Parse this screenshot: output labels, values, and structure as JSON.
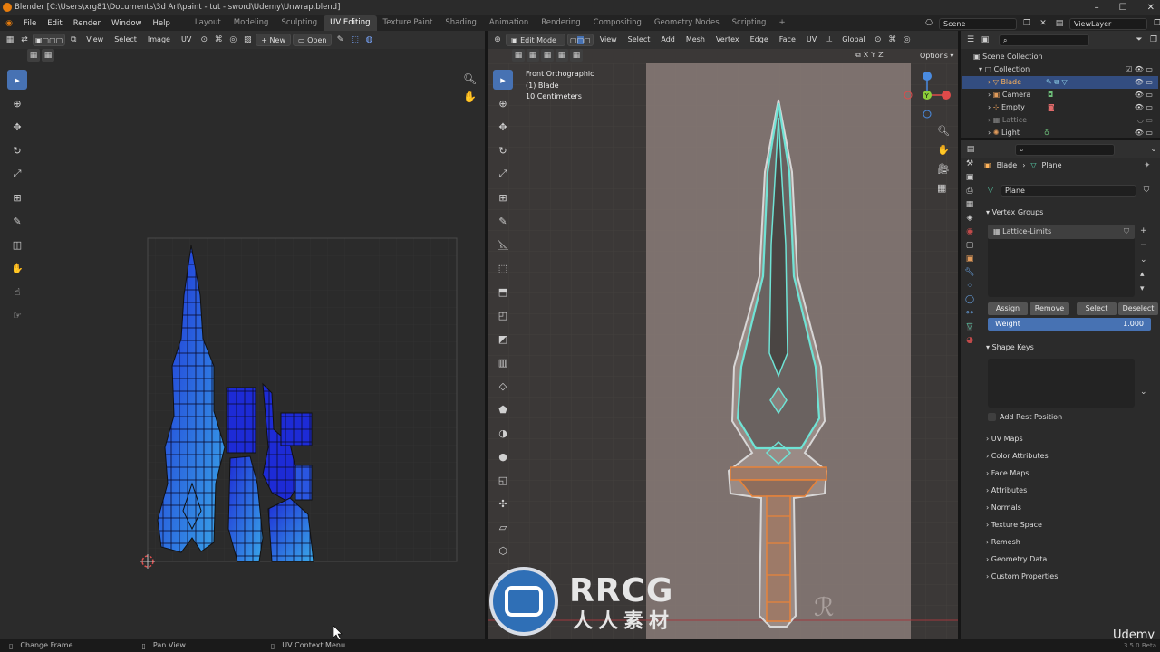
{
  "window": {
    "title": "Blender [C:\\Users\\xrg81\\Documents\\3d Art\\paint - tut - sword\\Udemy\\Unwrap.blend]"
  },
  "menus": [
    "File",
    "Edit",
    "Render",
    "Window",
    "Help"
  ],
  "workspaces": [
    "Layout",
    "Modeling",
    "Sculpting",
    "UV Editing",
    "Texture Paint",
    "Shading",
    "Animation",
    "Rendering",
    "Compositing",
    "Geometry Nodes",
    "Scripting",
    "+"
  ],
  "scene": {
    "label": "Scene",
    "view_layer": "ViewLayer"
  },
  "uv_editor": {
    "menus": [
      "View",
      "Select",
      "Image",
      "UV"
    ],
    "new_label": "New",
    "open_label": "Open"
  },
  "viewport": {
    "mode": "Edit Mode",
    "menus": [
      "View",
      "Select",
      "Add",
      "Mesh",
      "Vertex",
      "Edge",
      "Face",
      "UV"
    ],
    "orientation": "Global",
    "options_label": "Options",
    "axes": [
      "X",
      "Y",
      "Z"
    ],
    "info_line1": "Front Orthographic",
    "info_line2": "(1) Blade",
    "info_line3": "10 Centimeters"
  },
  "outliner": {
    "scene_collection": "Scene Collection",
    "collection": "Collection",
    "items": [
      "Blade",
      "Camera",
      "Empty",
      "Lattice",
      "Light"
    ]
  },
  "properties": {
    "breadcrumb_object": "Blade",
    "breadcrumb_data": "Plane",
    "mesh_name": "Plane",
    "vertex_groups_title": "Vertex Groups",
    "vertex_group_item": "Lattice-Limits",
    "assign": "Assign",
    "remove": "Remove",
    "select": "Select",
    "deselect": "Deselect",
    "weight_label": "Weight",
    "weight_value": "1.000",
    "weight_fraction": 1.0,
    "shape_keys_title": "Shape Keys",
    "add_rest_position": "Add Rest Position",
    "panels": [
      "UV Maps",
      "Color Attributes",
      "Face Maps",
      "Attributes",
      "Normals",
      "Texture Space",
      "Remesh",
      "Geometry Data",
      "Custom Properties"
    ]
  },
  "statusbar": {
    "item1": "Change Frame",
    "item2": "Pan View",
    "item3": "UV Context Menu",
    "version": "3.5.0 Beta"
  },
  "watermark": {
    "brand": "RRCG",
    "sub": "人人素材",
    "udemy": "Udemy"
  },
  "colors": {
    "accent": "#4772b3",
    "uv_blue": "#1d2bd6",
    "uv_cyan": "#3aa8e8",
    "edge_cyan": "#6fe3d5",
    "edge_orange": "#e8833a",
    "viewport_bg": "#413c3a",
    "ref_image": "#857874"
  }
}
